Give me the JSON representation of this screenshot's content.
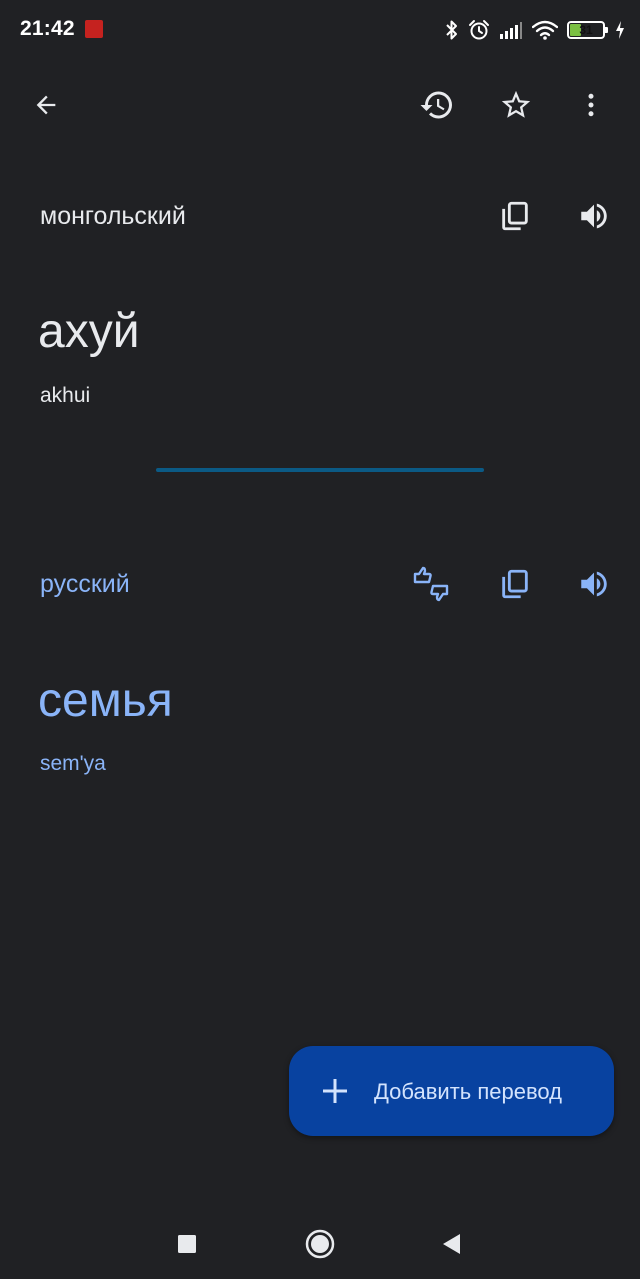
{
  "status_bar": {
    "time": "21:42",
    "battery_level": "31",
    "battery_fraction": 0.31,
    "icons": [
      "app-notification-icon",
      "bluetooth-icon",
      "alarm-icon",
      "signal-icon",
      "wifi-icon",
      "battery-icon",
      "charging-icon"
    ]
  },
  "toolbar": {
    "icons": [
      "back-arrow-icon",
      "history-icon",
      "star-icon",
      "more-vert-icon"
    ]
  },
  "source": {
    "language": "монгольский",
    "text": "ахуй",
    "transliteration": "akhui",
    "icons": [
      "copy-icon",
      "speaker-icon"
    ]
  },
  "target": {
    "language": "русский",
    "text": "семья",
    "transliteration": "sem'ya",
    "icons": [
      "feedback-thumbs-icon",
      "copy-icon",
      "speaker-icon"
    ]
  },
  "fab": {
    "label": "Добавить перевод",
    "icon": "plus-icon"
  },
  "nav_bar": {
    "icons": [
      "recents-square-icon",
      "home-circle-icon",
      "back-triangle-icon"
    ]
  },
  "colors": {
    "background": "#202124",
    "primary_text": "#e8eaed",
    "accent_text": "#8ab4f8",
    "divider": "#0b5a85",
    "fab_background": "#0842a0",
    "fab_text": "#d3e3fd"
  }
}
